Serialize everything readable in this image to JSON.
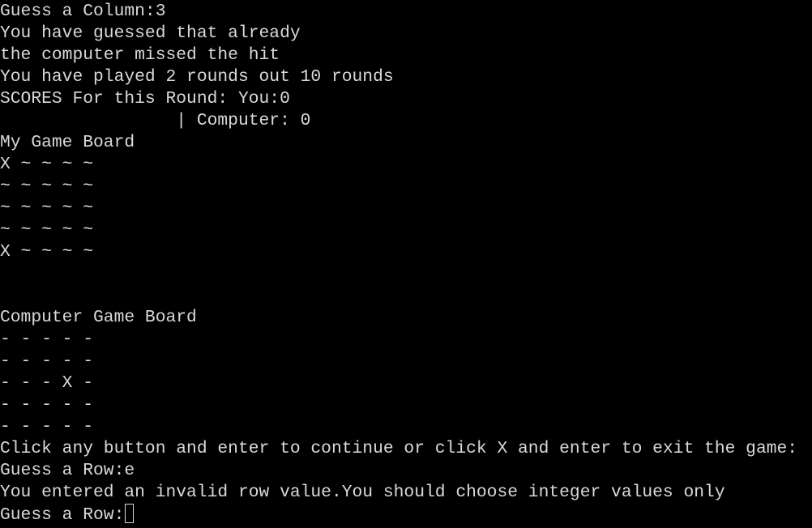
{
  "terminal": {
    "lines": [
      "Guess a Column:3",
      "You have guessed that already",
      "the computer missed the hit",
      "You have played 2 rounds out 10 rounds",
      "SCORES For this Round: You:0",
      "                 | Computer: 0",
      "My Game Board",
      "X ~ ~ ~ ~",
      "~ ~ ~ ~ ~",
      "~ ~ ~ ~ ~",
      "~ ~ ~ ~ ~",
      "X ~ ~ ~ ~",
      "",
      "",
      "Computer Game Board",
      "- - - - -",
      "- - - - -",
      "- - - X -",
      "- - - - -",
      "- - - - -",
      "Click any button and enter to continue or click X and enter to exit the game:",
      "Guess a Row:e",
      "You entered an invalid row value.You should choose integer values only"
    ],
    "prompt": "Guess a Row:",
    "input_value": ""
  },
  "colors": {
    "background": "#000000",
    "text": "#d9d9d9"
  }
}
